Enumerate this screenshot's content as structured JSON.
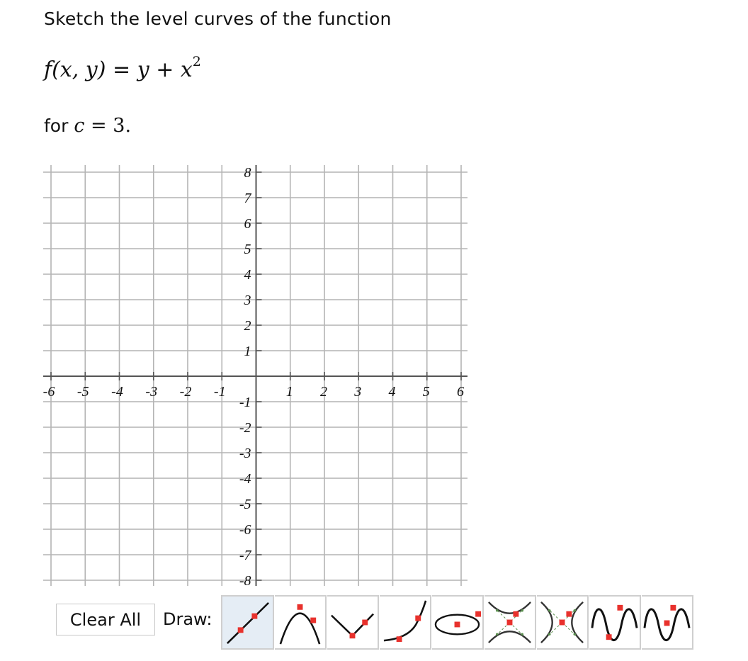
{
  "question": {
    "prompt": "Sketch the level curves of the function",
    "function_lhs": "f(x, y)",
    "function_eq": "=",
    "function_rhs_y": "y",
    "function_rhs_plus": "+",
    "function_rhs_x": "x",
    "function_rhs_exp": "2",
    "for_prefix": "for",
    "c_var": "c",
    "c_eq": "=",
    "c_value": "3."
  },
  "chart_data": {
    "type": "scatter",
    "title": "",
    "xlabel": "",
    "ylabel": "",
    "xlim": [
      -6,
      6
    ],
    "ylim": [
      -8,
      8
    ],
    "grid": true,
    "x_ticks": [
      "-6",
      "-5",
      "-4",
      "-3",
      "-2",
      "-1",
      "1",
      "2",
      "3",
      "4",
      "5",
      "6"
    ],
    "x_tick_values": [
      -6,
      -5,
      -4,
      -3,
      -2,
      -1,
      1,
      2,
      3,
      4,
      5,
      6
    ],
    "y_ticks": [
      "8",
      "7",
      "6",
      "5",
      "4",
      "3",
      "2",
      "1",
      "-1",
      "-2",
      "-3",
      "-4",
      "-5",
      "-6",
      "-7",
      "-8"
    ],
    "y_tick_values": [
      8,
      7,
      6,
      5,
      4,
      3,
      2,
      1,
      -1,
      -2,
      -3,
      -4,
      -5,
      -6,
      -7,
      -8
    ],
    "series": []
  },
  "controls": {
    "clear_all_label": "Clear All",
    "draw_label": "Draw:",
    "tools": [
      {
        "name": "line-tool",
        "icon": "line-icon",
        "active": true
      },
      {
        "name": "parabola-down-tool",
        "icon": "parabola-down-icon",
        "active": false
      },
      {
        "name": "absolute-value-tool",
        "icon": "absolute-value-icon",
        "active": false
      },
      {
        "name": "exponential-tool",
        "icon": "exponential-icon",
        "active": false
      },
      {
        "name": "ellipse-tool",
        "icon": "ellipse-icon",
        "active": false
      },
      {
        "name": "hyperbola-vertical-tool",
        "icon": "hyperbola-vertical-icon",
        "active": false
      },
      {
        "name": "hyperbola-horizontal-tool",
        "icon": "hyperbola-horizontal-icon",
        "active": false
      },
      {
        "name": "sine-tool",
        "icon": "sine-icon",
        "active": false
      },
      {
        "name": "cosine-tool",
        "icon": "cosine-icon",
        "active": false
      }
    ]
  },
  "colors": {
    "grid": "#b4b4b4",
    "axis": "#555555",
    "point": "#e8312c",
    "asymptote": "#5a8f4e",
    "active_tool_bg": "#e5edf5"
  }
}
